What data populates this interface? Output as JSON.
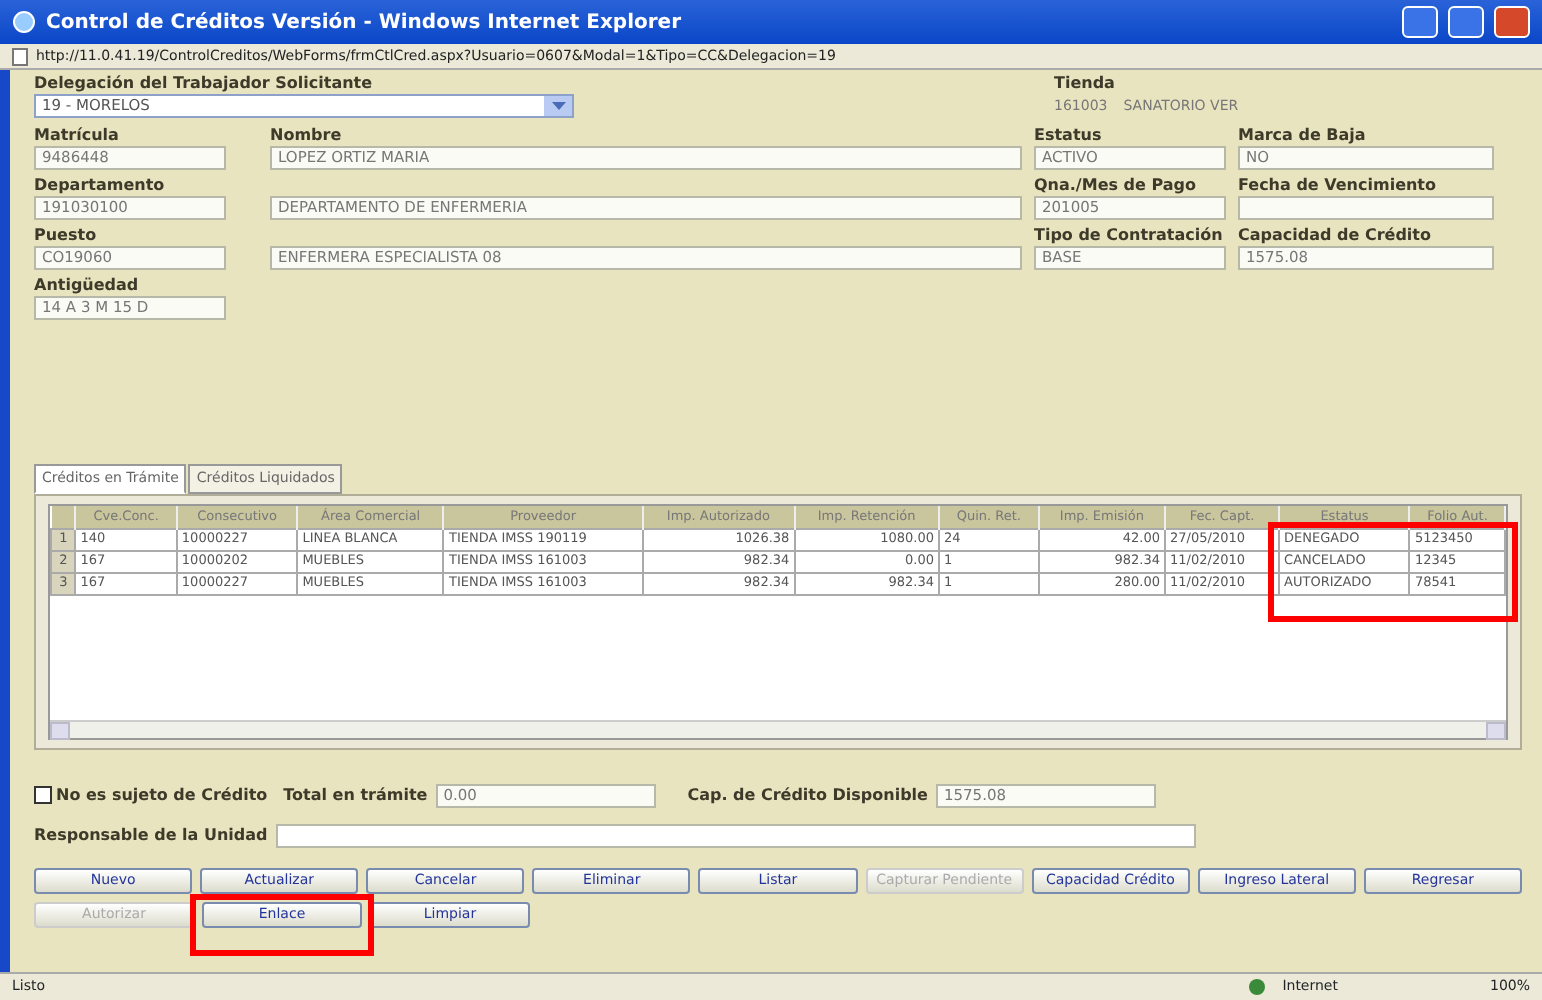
{
  "window": {
    "title": "Control de Créditos Versión - Windows Internet Explorer",
    "address": "http://11.0.41.19/ControlCreditos/WebForms/frmCtlCred.aspx?Usuario=0607&Modal=1&Tipo=CC&Delegacion=19"
  },
  "delegacion": {
    "label": "Delegación del Trabajador Solicitante",
    "value": "19 - MORELOS"
  },
  "tienda": {
    "label": "Tienda",
    "code": "161003",
    "name": "SANATORIO VER"
  },
  "field_rows": [
    [
      {
        "label": "Matrícula",
        "value": "9486448"
      },
      {
        "label": "Nombre",
        "value": "LOPEZ ORTIZ MARIA"
      },
      {
        "label": "Estatus",
        "value": "ACTIVO"
      },
      {
        "label": "Marca de Baja",
        "value": "NO"
      }
    ],
    [
      {
        "label": "Departamento",
        "value": "191030100"
      },
      {
        "value": "DEPARTAMENTO DE ENFERMERIA"
      },
      {
        "label": "Qna./Mes de Pago",
        "value": "201005"
      },
      {
        "label": "Fecha de Vencimiento"
      }
    ],
    [
      {
        "label": "Puesto",
        "value": "CO19060"
      },
      {
        "value": "ENFERMERA ESPECIALISTA 08"
      },
      {
        "label": "Tipo de Contratación",
        "value": "BASE"
      },
      {
        "label": "Capacidad de Crédito",
        "value": "1575.08"
      }
    ],
    [
      {
        "label": "Antigüedad",
        "value": "14 A 3 M 15 D"
      }
    ]
  ],
  "tabs": [
    {
      "label": "Créditos en Trámite",
      "selected": true
    },
    {
      "label": "Créditos Liquidados",
      "selected": false
    }
  ],
  "table": {
    "columns": [
      {
        "label": "Cve.Conc.",
        "highlighted": false
      },
      {
        "label": "Consecutivo",
        "highlighted": false
      },
      {
        "label": "Área Comercial",
        "highlighted": false
      },
      {
        "label": "Proveedor",
        "highlighted": false
      },
      {
        "label": "Imp. Autorizado",
        "highlighted": false
      },
      {
        "label": "Imp. Retención",
        "highlighted": false
      },
      {
        "label": "Quin. Ret.",
        "highlighted": false
      },
      {
        "label": "Imp. Emisión",
        "highlighted": false
      },
      {
        "label": "Fec. Capt.",
        "highlighted": false
      },
      {
        "label": "Estatus",
        "highlighted": true
      },
      {
        "label": "Folio Aut.",
        "highlighted": true
      }
    ],
    "rows": [
      {
        "number": "1",
        "cells": [
          "140",
          "10000227",
          "LINEA BLANCA",
          "TIENDA IMSS 190119",
          "1026.38",
          "1080.00",
          "24",
          "42.00",
          "27/05/2010",
          "DENEGADO",
          "5123450"
        ]
      },
      {
        "number": "2",
        "cells": [
          "167",
          "10000202",
          "MUEBLES",
          "TIENDA IMSS 161003",
          "982.34",
          "0.00",
          "1",
          "982.34",
          "11/02/2010",
          "CANCELADO",
          "12345"
        ]
      },
      {
        "number": "3",
        "cells": [
          "167",
          "10000227",
          "MUEBLES",
          "TIENDA IMSS 161003",
          "982.34",
          "982.34",
          "1",
          "280.00",
          "11/02/2010",
          "AUTORIZADO",
          "78541"
        ]
      }
    ]
  },
  "no_sujeto": {
    "label": "No es sujeto de Crédito",
    "checked": false
  },
  "total": {
    "label": "Total en trámite",
    "value": "0.00"
  },
  "disponible": {
    "label": "Cap. de Crédito Disponible",
    "value": "1575.08"
  },
  "responsable": {
    "label": "Responsable de la Unidad"
  },
  "buttons": [
    [
      {
        "label": "Nuevo",
        "disabled": false,
        "highlighted": false
      },
      {
        "label": "Actualizar",
        "disabled": false,
        "highlighted": false
      },
      {
        "label": "Cancelar",
        "disabled": false,
        "highlighted": false
      },
      {
        "label": "Eliminar",
        "disabled": false,
        "highlighted": false
      },
      {
        "label": "Listar",
        "disabled": false,
        "highlighted": false
      },
      {
        "label": "Capturar Pendiente",
        "disabled": true,
        "highlighted": false
      },
      {
        "label": "Capacidad Crédito",
        "disabled": false,
        "highlighted": false
      },
      {
        "label": "Ingreso Lateral",
        "disabled": false,
        "highlighted": false
      },
      {
        "label": "Regresar",
        "disabled": false,
        "highlighted": false
      }
    ],
    [
      {
        "label": "Autorizar",
        "disabled": true,
        "highlighted": false
      },
      {
        "label": "Enlace",
        "disabled": false,
        "highlighted": true
      },
      {
        "label": "Limpiar",
        "disabled": false,
        "highlighted": false
      }
    ]
  ],
  "status_bar": {
    "text": "Listo",
    "zone": "Internet",
    "zoom": "100%"
  }
}
